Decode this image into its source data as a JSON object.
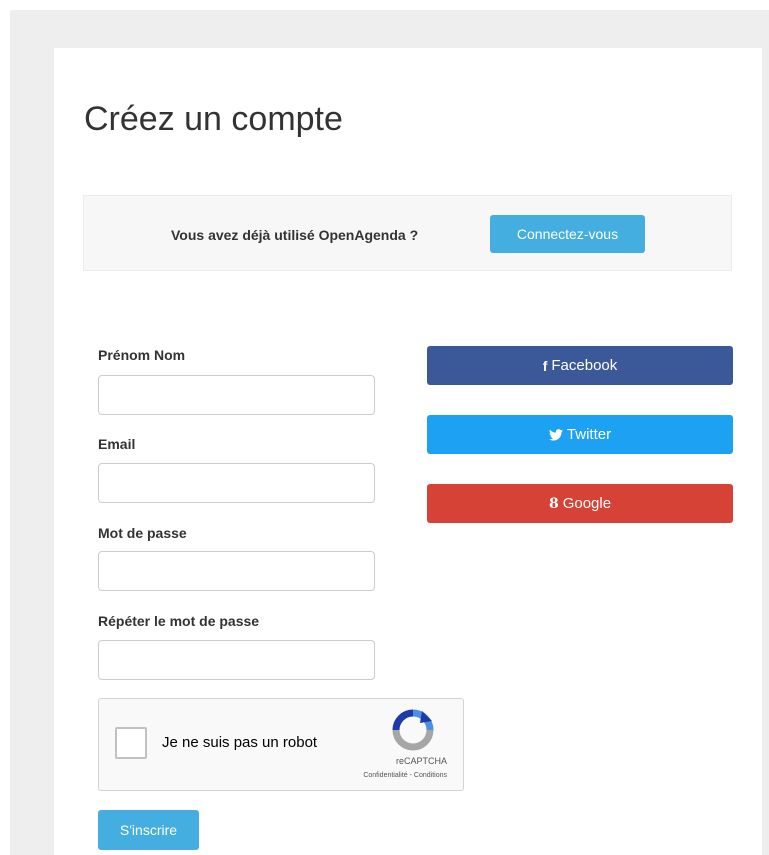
{
  "page": {
    "title": "Créez un compte"
  },
  "login_prompt": {
    "text": "Vous avez déjà utilisé OpenAgenda ?",
    "button_label": "Connectez-vous"
  },
  "form": {
    "fields": [
      {
        "label": "Prénom Nom",
        "value": "",
        "placeholder": ""
      },
      {
        "label": "Email",
        "value": "",
        "placeholder": ""
      },
      {
        "label": "Mot de passe",
        "value": "",
        "placeholder": ""
      },
      {
        "label": "Répéter le mot de passe",
        "value": "",
        "placeholder": ""
      }
    ],
    "submit_label": "S'inscrire"
  },
  "social": [
    {
      "label": "Facebook",
      "icon": "facebook-icon",
      "glyph": "f",
      "color": "#3b5998"
    },
    {
      "label": "Twitter",
      "icon": "twitter-icon",
      "glyph": "",
      "color": "#1da1f2"
    },
    {
      "label": "Google",
      "icon": "google-icon",
      "glyph": "8",
      "color": "#d64236"
    }
  ],
  "captcha": {
    "label": "Je ne suis pas un robot",
    "brand": "reCAPTCHA",
    "links": "Confidentialité - Conditions",
    "checked": false
  },
  "colors": {
    "accent": "#45aee0",
    "page_bg": "#eeeeee"
  }
}
